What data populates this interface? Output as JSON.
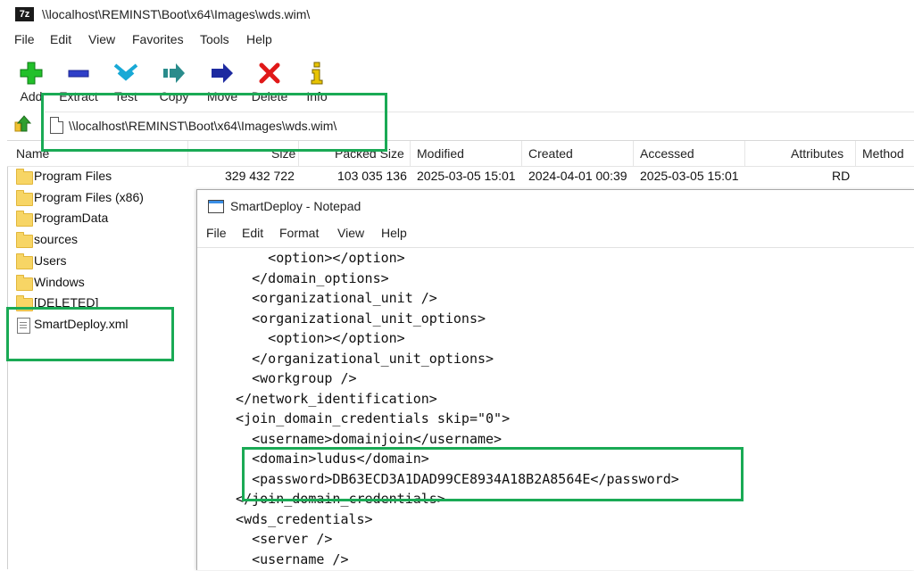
{
  "window": {
    "title": "\\\\localhost\\REMINST\\Boot\\x64\\Images\\wds.wim\\",
    "app_icon_text": "7z"
  },
  "menu": [
    "File",
    "Edit",
    "View",
    "Favorites",
    "Tools",
    "Help"
  ],
  "toolbar": [
    {
      "label": "Add",
      "icon": "plus-icon"
    },
    {
      "label": "Extract",
      "icon": "minus-icon"
    },
    {
      "label": "Test",
      "icon": "double-chevron-down-icon"
    },
    {
      "label": "Copy",
      "icon": "arrow-right-icon"
    },
    {
      "label": "Move",
      "icon": "arrow-right-icon"
    },
    {
      "label": "Delete",
      "icon": "x-icon"
    },
    {
      "label": "Info",
      "icon": "info-icon"
    }
  ],
  "address": {
    "path": "\\\\localhost\\REMINST\\Boot\\x64\\Images\\wds.wim\\"
  },
  "columns": [
    "Name",
    "Size",
    "Packed Size",
    "Modified",
    "Created",
    "Accessed",
    "Attributes",
    "Method"
  ],
  "files": [
    {
      "name": "Program Files",
      "type": "folder",
      "size": "329 432 722",
      "packed": "103 035 136",
      "modified": "2025-03-05 15:01",
      "created": "2024-04-01 00:39",
      "accessed": "2025-03-05 15:01",
      "attributes": "RD"
    },
    {
      "name": "Program Files (x86)",
      "type": "folder"
    },
    {
      "name": "ProgramData",
      "type": "folder"
    },
    {
      "name": "sources",
      "type": "folder"
    },
    {
      "name": "Users",
      "type": "folder"
    },
    {
      "name": "Windows",
      "type": "folder"
    },
    {
      "name": "[DELETED]",
      "type": "folder"
    },
    {
      "name": "SmartDeploy.xml",
      "type": "xml"
    }
  ],
  "notepad": {
    "title": "SmartDeploy - Notepad",
    "menu": [
      "File",
      "Edit",
      "Format",
      "View",
      "Help"
    ],
    "lines": [
      "      <option></option>",
      "    </domain_options>",
      "    <organizational_unit />",
      "    <organizational_unit_options>",
      "      <option></option>",
      "    </organizational_unit_options>",
      "    <workgroup />",
      "  </network_identification>",
      "  <join_domain_credentials skip=\"0\">",
      "    <username>domainjoin</username>",
      "    <domain>ludus</domain>",
      "    <password>DB63ECD3A1DAD99CE8934A18B2A8564E</password>",
      "  </join_domain_credentials>",
      "  <wds_credentials>",
      "    <server />",
      "    <username />"
    ]
  },
  "colors": {
    "highlight": "#1aaa55",
    "folder": "#f7d565"
  }
}
